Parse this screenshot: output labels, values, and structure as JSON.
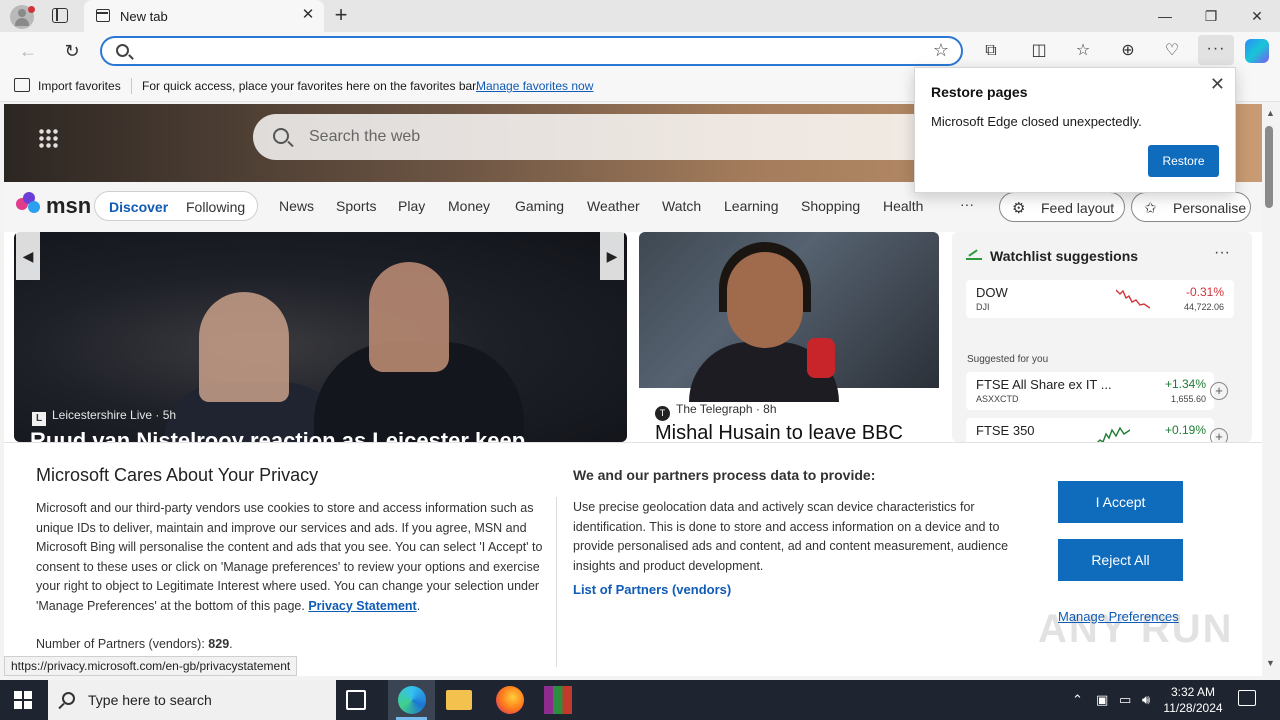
{
  "browser": {
    "tab_title": "New tab",
    "address_value": "",
    "favorites": {
      "import_label": "Import favorites",
      "hint": "For quick access, place your favorites here on the favorites bar.",
      "manage_link": "Manage favorites now"
    },
    "status_url": "https://privacy.microsoft.com/en-gb/privacystatement"
  },
  "restore_popup": {
    "title": "Restore pages",
    "message": "Microsoft Edge closed unexpectedly.",
    "button": "Restore"
  },
  "msn": {
    "search_placeholder": "Search the web",
    "logo_text": "msn",
    "tabs": {
      "discover": "Discover",
      "following": "Following"
    },
    "nav": [
      "News",
      "Sports",
      "Play",
      "Money",
      "Gaming",
      "Weather",
      "Watch",
      "Learning",
      "Shopping",
      "Health"
    ],
    "more": "···",
    "feed_layout": "Feed layout",
    "personalise": "Personalise",
    "main_card": {
      "source_initial": "L",
      "source": "Leicestershire Live",
      "age": "· 5h",
      "headline": "Ruud van Nistelrooy reaction as Leicester keep ..."
    },
    "side_card": {
      "source": "The Telegraph",
      "age": "· 8h",
      "headline": "Mishal Husain to leave BBC"
    },
    "watchlist": {
      "title": "Watchlist suggestions",
      "more": "···",
      "top": {
        "symbol": "DOW",
        "sub": "DJI",
        "change": "-0.31%",
        "value": "44,722.06",
        "trend": "down"
      },
      "suggested_label": "Suggested for you",
      "suggested": [
        {
          "symbol": "FTSE All Share ex IT ...",
          "sub": "ASXXCTD",
          "change": "+1.34%",
          "value": "1,655.60",
          "trend": "up"
        },
        {
          "symbol": "FTSE 350",
          "sub": "",
          "change": "+0.19%",
          "value": "",
          "trend": "up"
        }
      ]
    }
  },
  "privacy": {
    "title": "Microsoft Cares About Your Privacy",
    "body": "Microsoft and our third-party vendors use cookies to store and access information such as unique IDs to deliver, maintain and improve our services and ads. If you agree, MSN and Microsoft Bing will personalise the content and ads that you see. You can select 'I Accept' to consent to these uses or click on 'Manage preferences' to review your options and exercise your right to object to Legitimate Interest where used.  You can change your selection under 'Manage Preferences' at the bottom of this page.",
    "privacy_link": "Privacy Statement",
    "partners_label": "Number of Partners (vendors):",
    "partners_count": "829",
    "process_title": "We and our partners process data to provide:",
    "process_body": "Use precise geolocation data and actively scan device characteristics for identification. This is done to store and access information on a device and to provide personalised ads and content, ad and content measurement, audience insights and product development.",
    "partners_link": "List of Partners (vendors)",
    "accept": "I Accept",
    "reject": "Reject All",
    "manage": "Manage Preferences"
  },
  "watermark": "ANY RUN",
  "taskbar": {
    "search_placeholder": "Type here to search",
    "time": "3:32 AM",
    "date": "11/28/2024"
  },
  "colors": {
    "accent": "#0f6cbd",
    "link": "#0f5bb5",
    "negative": "#d13438",
    "positive": "#1e7d32"
  }
}
